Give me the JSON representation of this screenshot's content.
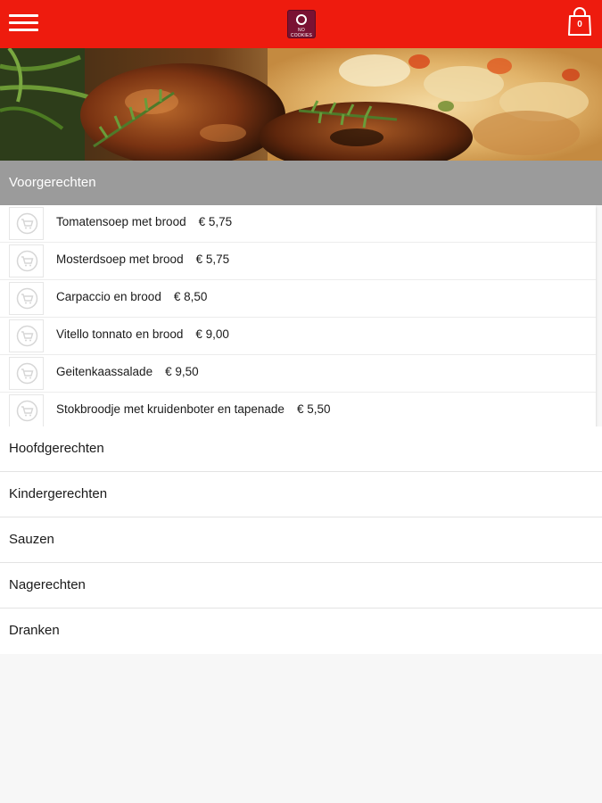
{
  "topbar": {
    "background": "#ee1b0e",
    "menu_icon": "hamburger-menu-icon",
    "logo_text": "NO COOKIES",
    "cart_icon": "shopping-bag-icon",
    "cart_count": "0"
  },
  "hero": {
    "image": "food-banner-image"
  },
  "expanded_category": {
    "label": "Voorgerechten",
    "background": "#9b9b9b",
    "items": [
      {
        "name": "Tomatensoep met brood",
        "price": "€ 5,75",
        "icon": "add-to-cart-icon"
      },
      {
        "name": "Mosterdsoep met brood",
        "price": "€ 5,75",
        "icon": "add-to-cart-icon"
      },
      {
        "name": "Carpaccio en brood",
        "price": "€ 8,50",
        "icon": "add-to-cart-icon"
      },
      {
        "name": "Vitello tonnato en brood",
        "price": "€ 9,00",
        "icon": "add-to-cart-icon"
      },
      {
        "name": "Geitenkaassalade",
        "price": "€ 9,50",
        "icon": "add-to-cart-icon"
      },
      {
        "name": "Stokbroodje met kruidenboter en tapenade",
        "price": "€ 5,50",
        "icon": "add-to-cart-icon"
      }
    ]
  },
  "categories": [
    {
      "label": "Hoofdgerechten"
    },
    {
      "label": "Kindergerechten"
    },
    {
      "label": "Sauzen"
    },
    {
      "label": "Nagerechten"
    },
    {
      "label": "Dranken"
    }
  ]
}
